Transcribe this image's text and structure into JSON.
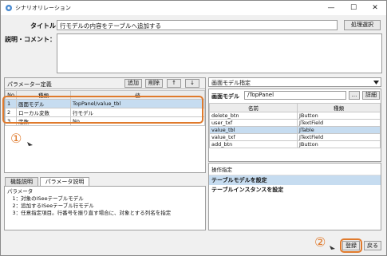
{
  "window": {
    "title": "シナリオリレーション",
    "controls": [
      "—",
      "☐",
      "✕"
    ]
  },
  "form": {
    "title_label": "タイトル：",
    "title_value": "行モデルの内容をテーブルへ追加する",
    "confirm_button": "処理選択",
    "description_label": "説明・コメント："
  },
  "params": {
    "header": "パラメーター定義",
    "buttons": [
      "追加",
      "削除",
      "↑",
      "↓"
    ],
    "columns": [
      "No",
      "種類",
      "値"
    ],
    "rows": [
      {
        "no": "1",
        "type": "画面モデル",
        "value": "TopPanel/value_tbl"
      },
      {
        "no": "2",
        "type": "ローカル変数",
        "value": "行モデル"
      },
      {
        "no": "3",
        "type": "定数",
        "value": "No"
      }
    ]
  },
  "tabs": {
    "items": [
      "機能説明",
      "パラメータ説明"
    ]
  },
  "param_desc": {
    "lines": [
      "パラメータ",
      "　1：対象のISeeテーブルモデル",
      "　2：追加するISeeテーブル行モデル",
      "　3：任意指定項目。行番号を振り直す場合に、対象とする列名を指定"
    ]
  },
  "screen_model": {
    "header": "画面モデル指定",
    "model_label": "画面モデル",
    "model_value": "/TopPanel",
    "more_button": "...",
    "detail_button": "詳細",
    "columns": [
      "名前",
      "種類"
    ],
    "rows": [
      {
        "name": "delete_btn",
        "kind": "JButton"
      },
      {
        "name": "user_txf",
        "kind": "JTextField"
      },
      {
        "name": "value_tbl",
        "kind": "JTable"
      },
      {
        "name": "value_txf",
        "kind": "JTextField"
      },
      {
        "name": "add_btn",
        "kind": "JButton"
      }
    ]
  },
  "ops": {
    "header": "操作指定",
    "items": [
      "テーブルモデルを設定",
      "テーブルインスタンスを設定"
    ]
  },
  "footer": {
    "register_button": "登録",
    "back_button": "戻る"
  },
  "markers": {
    "one": "①",
    "two": "②"
  }
}
